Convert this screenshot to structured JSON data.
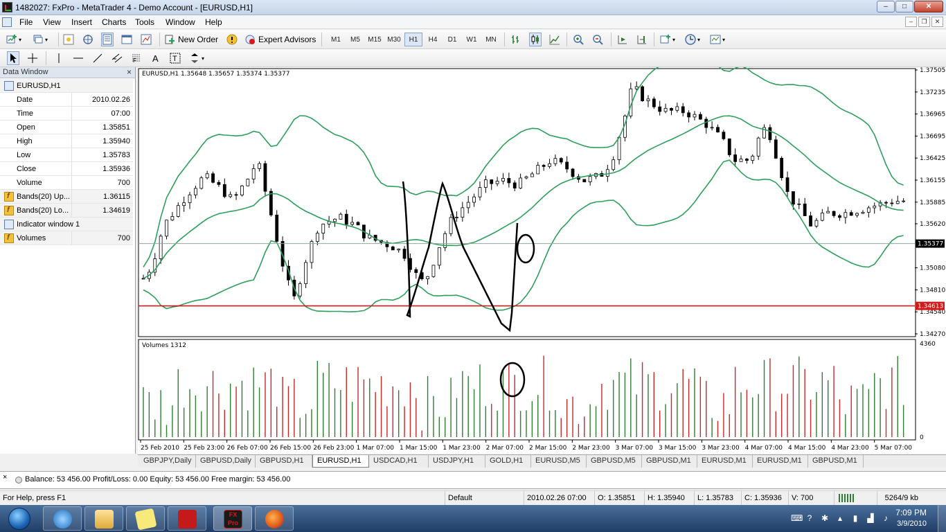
{
  "window": {
    "title": "1482027: FxPro - MetaTrader 4 - Demo Account - [EURUSD,H1]",
    "btn_min": "–",
    "btn_max": "□",
    "btn_close": "✕"
  },
  "menu": [
    "File",
    "View",
    "Insert",
    "Charts",
    "Tools",
    "Window",
    "Help"
  ],
  "toolbar": {
    "new_order": "New Order",
    "expert_advisors": "Expert Advisors",
    "timeframes": [
      "M1",
      "M5",
      "M15",
      "M30",
      "H1",
      "H4",
      "D1",
      "W1",
      "MN"
    ],
    "active_timeframe": "H1"
  },
  "data_window": {
    "title": "Data Window",
    "close": "×",
    "symbol": "EURUSD,H1",
    "rows": [
      {
        "label": "Date",
        "value": "2010.02.26"
      },
      {
        "label": "Time",
        "value": "07:00"
      },
      {
        "label": "Open",
        "value": "1.35851"
      },
      {
        "label": "High",
        "value": "1.35940"
      },
      {
        "label": "Low",
        "value": "1.35783"
      },
      {
        "label": "Close",
        "value": "1.35936"
      },
      {
        "label": "Volume",
        "value": "700"
      }
    ],
    "bands_up": {
      "label": "Bands(20) Up...",
      "value": "1.36115"
    },
    "bands_lo": {
      "label": "Bands(20) Lo...",
      "value": "1.34619"
    },
    "indicator_window": "Indicator window 1",
    "volumes": {
      "label": "Volumes",
      "value": "700"
    }
  },
  "chart": {
    "header": "EURUSD,H1  1.35648 1.35657 1.35374 1.35377",
    "price_labels": [
      "1.37505",
      "1.37235",
      "1.36965",
      "1.36695",
      "1.36425",
      "1.36155",
      "1.35885",
      "1.35620",
      "1.35080",
      "1.34810",
      "1.34540",
      "1.34270"
    ],
    "current_price": "1.35377",
    "red_line_price": "1.34613",
    "volume_header": "Volumes 1312",
    "volume_max": "4360",
    "volume_min": "0",
    "time_labels": [
      "25 Feb 2010",
      "25 Feb 23:00",
      "26 Feb 07:00",
      "26 Feb 15:00",
      "26 Feb 23:00",
      "1 Mar 07:00",
      "1 Mar 15:00",
      "1 Mar 23:00",
      "2 Mar 07:00",
      "2 Mar 15:00",
      "2 Mar 23:00",
      "3 Mar 07:00",
      "3 Mar 15:00",
      "3 Mar 23:00",
      "4 Mar 07:00",
      "4 Mar 15:00",
      "4 Mar 23:00",
      "5 Mar 07:00"
    ],
    "colors": {
      "bands": "#2e9e5b",
      "red_line": "#d11a1a",
      "vol_up": "#2e7d32",
      "vol_down": "#c62828"
    }
  },
  "tabs": [
    "GBPJPY,Daily",
    "GBPUSD,Daily",
    "GBPUSD,H1",
    "EURUSD,H1",
    "USDCAD,H1",
    "USDJPY,H1",
    "GOLD,H1",
    "EURUSD,M5",
    "GBPUSD,M5",
    "GBPUSD,M1",
    "EURUSD,M1",
    "EURUSD,M1",
    "GBPUSD,M1"
  ],
  "active_tab": "EURUSD,H1",
  "terminal": {
    "close": "×",
    "balance_text": "Balance: 53 456.00  Profit/Loss: 0.00  Equity: 53 456.00  Free margin: 53 456.00"
  },
  "status": {
    "help": "For Help, press F1",
    "profile": "Default",
    "datetime": "2010.02.26 07:00",
    "open": "O: 1.35851",
    "high": "H: 1.35940",
    "low": "L: 1.35783",
    "close": "C: 1.35936",
    "volume": "V: 700",
    "traffic": "5264/9 kb"
  },
  "taskbar": {
    "time": "7:09 PM",
    "date": "3/9/2010",
    "apps": [
      "windows-explorer-icon",
      "internet-explorer-icon",
      "folder-icon",
      "sticky-notes-icon",
      "pdf-icon",
      "fxpro-icon",
      "firefox-icon"
    ]
  }
}
